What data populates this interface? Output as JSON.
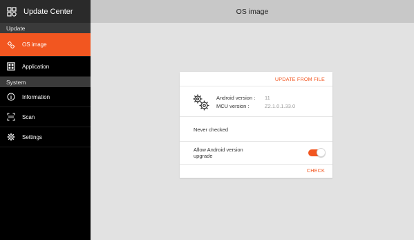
{
  "app": {
    "title": "Update Center",
    "icon": "app-grid-icon"
  },
  "sidebar": {
    "sections": [
      {
        "label": "Update"
      },
      {
        "label": "System"
      }
    ],
    "items": [
      {
        "label": "OS image",
        "icon": "os-image-icon",
        "active": true
      },
      {
        "label": "Application",
        "icon": "application-icon",
        "active": false
      },
      {
        "label": "Information",
        "icon": "info-icon",
        "active": false
      },
      {
        "label": "Scan",
        "icon": "scan-icon",
        "active": false
      },
      {
        "label": "Settings",
        "icon": "settings-icon",
        "active": false
      }
    ]
  },
  "header": {
    "title": "OS image"
  },
  "card": {
    "update_from_file": "UPDATE FROM FILE",
    "android_label": "Android version :",
    "android_value": "11",
    "mcu_label": "MCU version :",
    "mcu_value": "Z2.1.0.1.33.0",
    "status": "Never checked",
    "allow_upgrade_label": "Allow Android version upgrade",
    "allow_upgrade_enabled": true,
    "check": "CHECK"
  },
  "colors": {
    "accent": "#f25620",
    "sidebar_bg": "#000000",
    "section_bg": "#3a3a3a",
    "topbar_bg": "#c8c8c8",
    "page_bg": "#e2e2e2"
  }
}
